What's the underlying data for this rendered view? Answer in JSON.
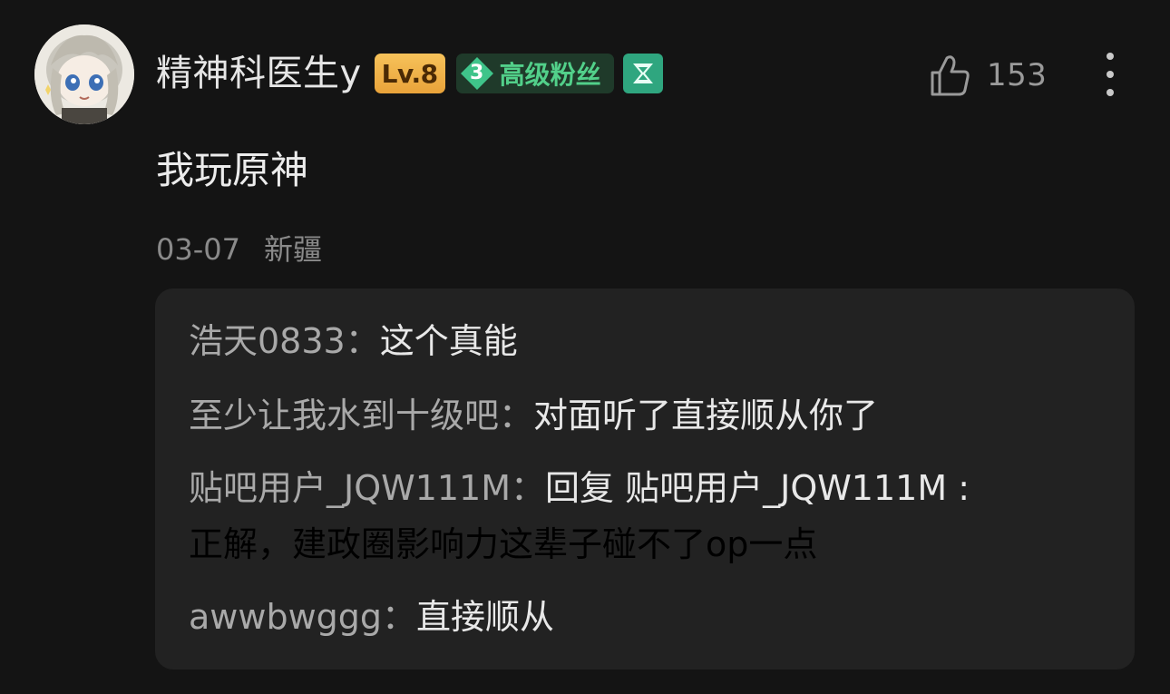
{
  "post": {
    "username": "精神科医生y",
    "level": "Lv.8",
    "fan_badge": {
      "number": "3",
      "label": "高级粉丝",
      "color": "#52d08a"
    },
    "extra_badge_icon": "hourglass-icon",
    "likes": "153",
    "content": "我玩原神",
    "date": "03-07",
    "location": "新疆"
  },
  "replies": [
    {
      "author": "浩天0833",
      "separator": "：",
      "text": "这个真能"
    },
    {
      "author": "至少让我水到十级吧",
      "separator": "：",
      "text": "对面听了直接顺从你了"
    },
    {
      "author": "贴吧用户_JQW111M",
      "separator": "：",
      "text": "回复 贴吧用户_JQW111M :",
      "continuation": "正解，建政圈影响力这辈子碰不了op一点"
    },
    {
      "author": "awwbwggg",
      "separator": "：",
      "text": "直接顺从"
    }
  ],
  "colors": {
    "background": "#141414",
    "reply_panel": "#222222",
    "level_badge": "#f6c25a",
    "fan_badge_bg": "#1f3a2a",
    "extra_badge": "#2fa67f"
  }
}
